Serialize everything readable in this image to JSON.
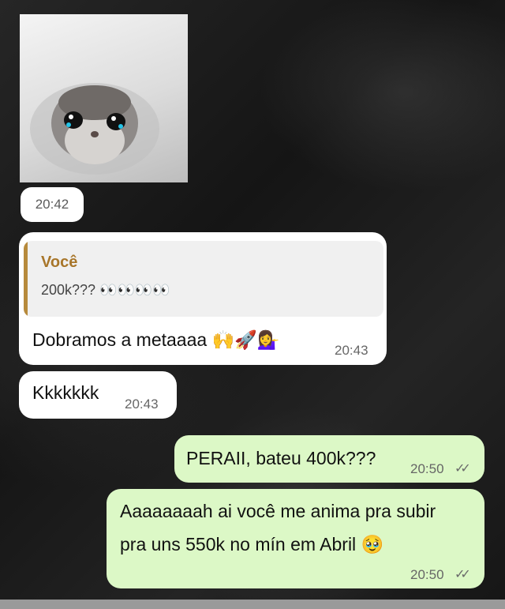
{
  "messages": [
    {
      "type": "image",
      "direction": "incoming",
      "time": "20:42",
      "image_icon": "sad-hamster-sticker"
    },
    {
      "type": "reply",
      "direction": "incoming",
      "quoted": {
        "author": "Você",
        "text": "200k??? 👀👀👀👀"
      },
      "text": "Dobramos a metaaaa 🙌🚀💁‍♀️",
      "time": "20:43"
    },
    {
      "type": "text",
      "direction": "incoming",
      "text": "Kkkkkkk",
      "time": "20:43"
    },
    {
      "type": "text",
      "direction": "outgoing",
      "text": "PERAII, bateu 400k???",
      "time": "20:50",
      "status": "read"
    },
    {
      "type": "text",
      "direction": "outgoing",
      "lines": [
        "Aaaaaaaah ai você me anima pra subir",
        "pra uns 550k no mín em Abril 🥹"
      ],
      "time": "20:50",
      "status": "read"
    }
  ],
  "colors": {
    "incoming_bubble": "#ffffff",
    "outgoing_bubble": "#dcf8c6",
    "quote_accent": "#b78a3c",
    "background": "#1c1c1c"
  }
}
